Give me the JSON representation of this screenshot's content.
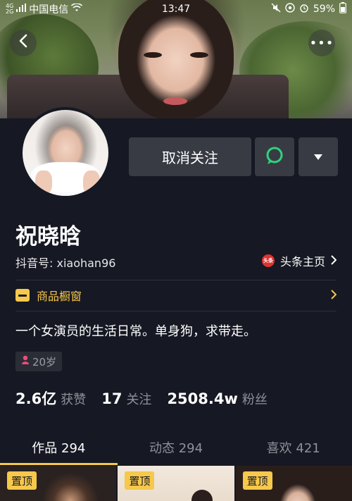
{
  "status_bar": {
    "signal_top": "4G",
    "signal_bottom": "2G",
    "carrier": "中国电信",
    "time": "13:47",
    "battery": "59%",
    "icons": [
      "wifi-icon",
      "mute-icon",
      "location-icon",
      "alarm-icon",
      "battery-icon"
    ]
  },
  "header": {
    "back_icon": "chevron-left-icon",
    "more_icon": "more-dots-icon",
    "more_label": "•••"
  },
  "actions": {
    "unfollow_label": "取消关注",
    "message_icon": "chat-bubble-icon",
    "dropdown_icon": "triangle-down-icon"
  },
  "profile": {
    "name": "祝晓晗",
    "douyin_id": "抖音号: xiaohan96",
    "toutiao_logo_text": "头条",
    "toutiao_label": "头条主页",
    "shop_label": "商品橱窗",
    "bio": "一个女演员的生活日常。单身狗，求带走。",
    "age_tag": "20岁",
    "gender_icon": "female-icon"
  },
  "stats": [
    {
      "value": "2.6亿",
      "label": "获赞"
    },
    {
      "value": "17",
      "label": "关注"
    },
    {
      "value": "2508.4w",
      "label": "粉丝"
    }
  ],
  "tabs": [
    {
      "label": "作品 294",
      "active": true
    },
    {
      "label": "动态 294",
      "active": false
    },
    {
      "label": "喜欢 421",
      "active": false
    }
  ],
  "videos": [
    {
      "pin_label": "置顶"
    },
    {
      "pin_label": "置顶"
    },
    {
      "pin_label": "置顶"
    }
  ],
  "colors": {
    "background": "#161823",
    "accent_yellow": "#f6c84b",
    "button_bg": "#393b44",
    "muted_text": "#8f9098",
    "chat_green": "#2fd37c"
  }
}
